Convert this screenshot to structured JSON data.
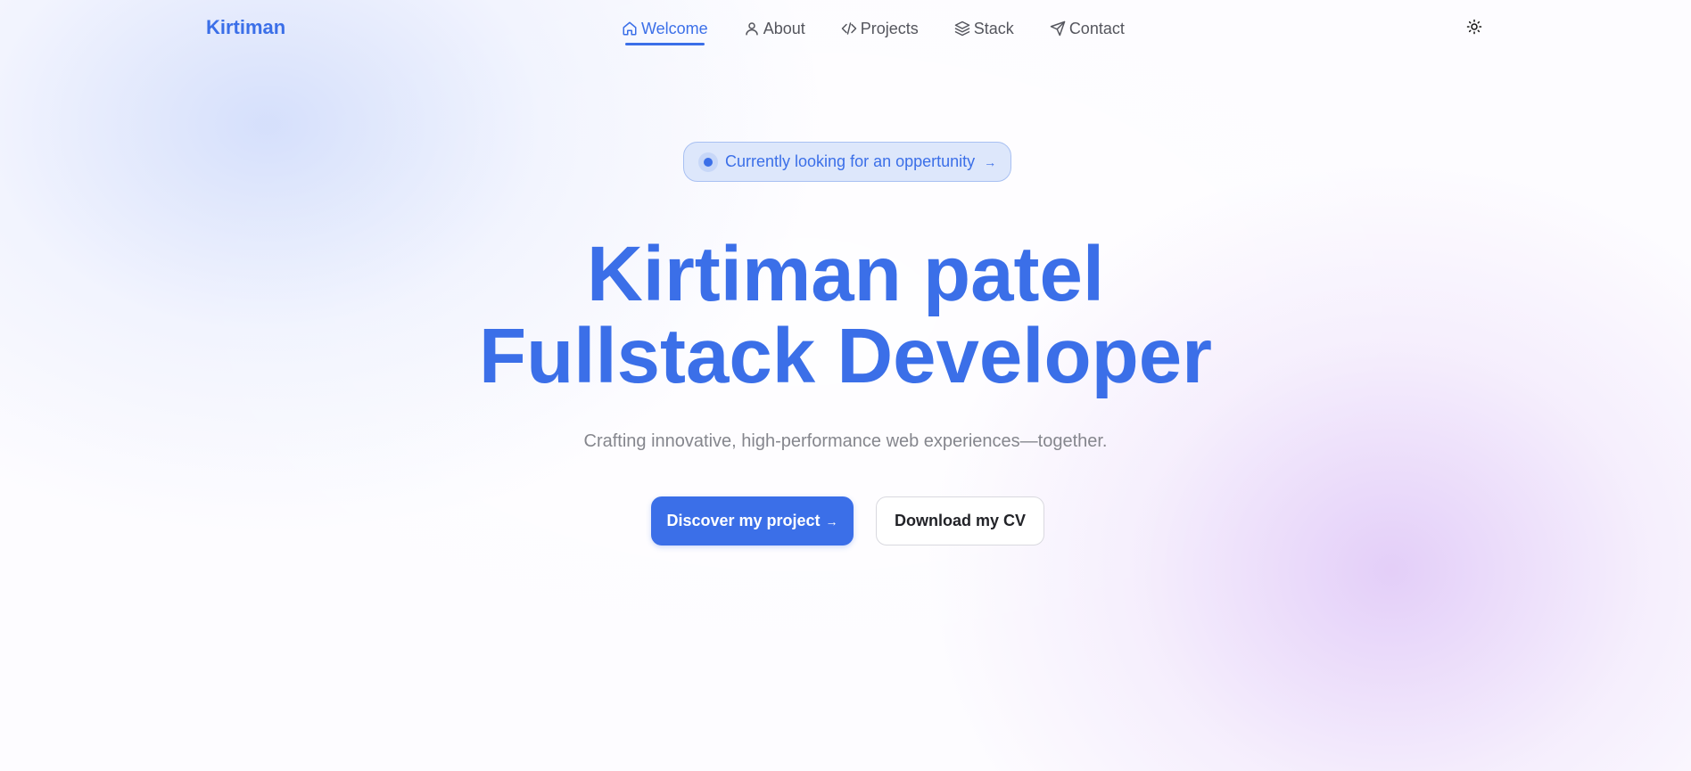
{
  "brand": {
    "name": "Kirtiman"
  },
  "nav": {
    "items": [
      {
        "label": "Welcome",
        "icon": "home-icon",
        "active": true
      },
      {
        "label": "About",
        "icon": "user-icon",
        "active": false
      },
      {
        "label": "Projects",
        "icon": "code-icon",
        "active": false
      },
      {
        "label": "Stack",
        "icon": "layers-icon",
        "active": false
      },
      {
        "label": "Contact",
        "icon": "send-icon",
        "active": false
      }
    ],
    "theme_toggle_icon": "sun-icon"
  },
  "hero": {
    "badge_text": "Currently looking for an oppertunity",
    "badge_arrow": "→",
    "headline_line1": "Kirtiman patel",
    "headline_line2": "Fullstack Developer",
    "subtitle": "Crafting innovative, high-performance web experiences—together.",
    "primary_button": "Discover my project",
    "primary_button_arrow": "→",
    "secondary_button": "Download my CV"
  },
  "colors": {
    "accent": "#3b6fe8",
    "text_muted": "#85868d",
    "nav_text": "#54555d",
    "badge_bg": "#dde7fb",
    "glow_blue": "#c8d6fa",
    "glow_purple": "#e2ccf8"
  }
}
